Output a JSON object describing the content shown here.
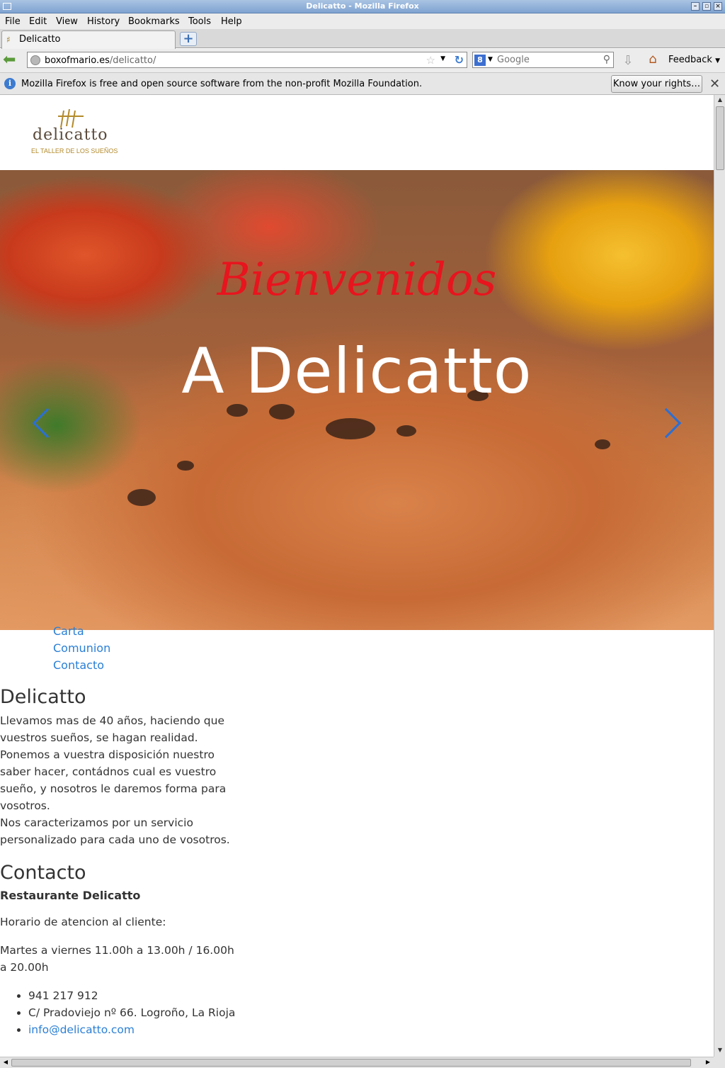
{
  "window": {
    "title": "Delicatto - Mozilla Firefox",
    "controls": [
      "–",
      "▫",
      "×"
    ]
  },
  "menubar": {
    "items": [
      "File",
      "Edit",
      "View",
      "History",
      "Bookmarks",
      "Tools",
      "Help"
    ]
  },
  "tabs": [
    {
      "label": "Delicatto"
    }
  ],
  "navbar": {
    "url_host": "boxofmario.es",
    "url_path": "/delicatto/",
    "search_placeholder": "Google",
    "search_engine_icon": "8",
    "feedback_label": "Feedback"
  },
  "infobar": {
    "message": "Mozilla Firefox is free and open source software from the non-profit Mozilla Foundation.",
    "button_label": "Know your rights…"
  },
  "page": {
    "logo": {
      "word": "delicatto",
      "tagline": "EL TALLER DE LOS SUEÑOS"
    },
    "hero": {
      "welcome": "Bienvenidos",
      "headline": "A Delicatto"
    },
    "nav": [
      "Carta",
      "Comunion",
      "Contacto"
    ],
    "about": {
      "title": "Delicatto",
      "paragraph1": "Llevamos mas de 40 años, haciendo que vuestros sueños, se hagan realidad. Ponemos a vuestra disposición nuestro saber hacer, contádnos cual es vuestro sueño, y nosotros le daremos forma para vosotros.",
      "paragraph2": "Nos caracterizamos por un servicio personalizado para cada uno de vosotros."
    },
    "contact": {
      "title": "Contacto",
      "name": "Restaurante Delicatto",
      "hours_label": "Horario de atencion al cliente:",
      "hours": "Martes a viernes 11.00h a 13.00h / 16.00h a 20.00h",
      "phone": "941 217 912",
      "address": "C/ Pradoviejo nº 66. Logroño, La Rioja",
      "email": "info@delicatto.com"
    }
  },
  "colors": {
    "link": "#2a7fd6",
    "welcome": "#e8141e",
    "titlebar": "#7fa3d0"
  }
}
